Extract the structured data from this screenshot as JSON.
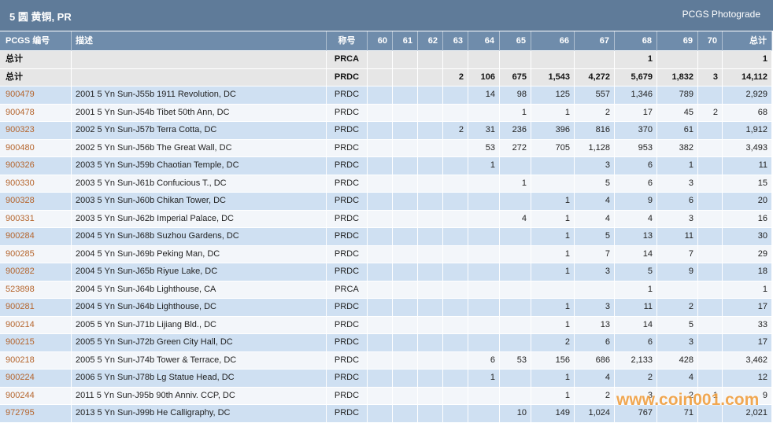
{
  "header": {
    "title": "5 圆 黄铜, PR",
    "photograde_link": "PCGS Photograde"
  },
  "table": {
    "columns": [
      "PCGS 编号",
      "描述",
      "称号",
      "60",
      "61",
      "62",
      "63",
      "64",
      "65",
      "66",
      "67",
      "68",
      "69",
      "70",
      "总计"
    ],
    "total_rows": [
      {
        "label": "总计",
        "description": "",
        "designation": "PRCA",
        "grades": [
          "",
          "",
          "",
          "",
          "",
          "",
          "",
          "",
          "1",
          "",
          ""
        ],
        "total": "1"
      },
      {
        "label": "总计",
        "description": "",
        "designation": "PRDC",
        "grades": [
          "",
          "",
          "",
          "2",
          "106",
          "675",
          "1,543",
          "4,272",
          "5,679",
          "1,832",
          "3"
        ],
        "total": "14,112"
      }
    ],
    "rows": [
      {
        "pcgs_no": "900479",
        "description": "2001 5 Yn Sun-J55b 1911 Revolution, DC",
        "designation": "PRDC",
        "grades": [
          "",
          "",
          "",
          "",
          "14",
          "98",
          "125",
          "557",
          "1,346",
          "789",
          ""
        ],
        "total": "2,929"
      },
      {
        "pcgs_no": "900478",
        "description": "2001 5 Yn Sun-J54b Tibet 50th Ann, DC",
        "designation": "PRDC",
        "grades": [
          "",
          "",
          "",
          "",
          "",
          "1",
          "1",
          "2",
          "17",
          "45",
          "2"
        ],
        "total": "68"
      },
      {
        "pcgs_no": "900323",
        "description": "2002 5 Yn Sun-J57b Terra Cotta, DC",
        "designation": "PRDC",
        "grades": [
          "",
          "",
          "",
          "2",
          "31",
          "236",
          "396",
          "816",
          "370",
          "61",
          ""
        ],
        "total": "1,912"
      },
      {
        "pcgs_no": "900480",
        "description": "2002 5 Yn Sun-J56b The Great Wall, DC",
        "designation": "PRDC",
        "grades": [
          "",
          "",
          "",
          "",
          "53",
          "272",
          "705",
          "1,128",
          "953",
          "382",
          ""
        ],
        "total": "3,493"
      },
      {
        "pcgs_no": "900326",
        "description": "2003 5 Yn Sun-J59b Chaotian Temple, DC",
        "designation": "PRDC",
        "grades": [
          "",
          "",
          "",
          "",
          "1",
          "",
          "",
          "3",
          "6",
          "1",
          ""
        ],
        "total": "11"
      },
      {
        "pcgs_no": "900330",
        "description": "2003 5 Yn Sun-J61b Confucious T., DC",
        "designation": "PRDC",
        "grades": [
          "",
          "",
          "",
          "",
          "",
          "1",
          "",
          "5",
          "6",
          "3",
          ""
        ],
        "total": "15"
      },
      {
        "pcgs_no": "900328",
        "description": "2003 5 Yn Sun-J60b Chikan Tower, DC",
        "designation": "PRDC",
        "grades": [
          "",
          "",
          "",
          "",
          "",
          "",
          "1",
          "4",
          "9",
          "6",
          ""
        ],
        "total": "20"
      },
      {
        "pcgs_no": "900331",
        "description": "2003 5 Yn Sun-J62b Imperial Palace, DC",
        "designation": "PRDC",
        "grades": [
          "",
          "",
          "",
          "",
          "",
          "4",
          "1",
          "4",
          "4",
          "3",
          ""
        ],
        "total": "16"
      },
      {
        "pcgs_no": "900284",
        "description": "2004 5 Yn Sun-J68b Suzhou Gardens, DC",
        "designation": "PRDC",
        "grades": [
          "",
          "",
          "",
          "",
          "",
          "",
          "1",
          "5",
          "13",
          "11",
          ""
        ],
        "total": "30"
      },
      {
        "pcgs_no": "900285",
        "description": "2004 5 Yn Sun-J69b Peking Man, DC",
        "designation": "PRDC",
        "grades": [
          "",
          "",
          "",
          "",
          "",
          "",
          "1",
          "7",
          "14",
          "7",
          ""
        ],
        "total": "29"
      },
      {
        "pcgs_no": "900282",
        "description": "2004 5 Yn Sun-J65b Riyue Lake, DC",
        "designation": "PRDC",
        "grades": [
          "",
          "",
          "",
          "",
          "",
          "",
          "1",
          "3",
          "5",
          "9",
          ""
        ],
        "total": "18"
      },
      {
        "pcgs_no": "523898",
        "description": "2004 5 Yn Sun-J64b Lighthouse, CA",
        "designation": "PRCA",
        "grades": [
          "",
          "",
          "",
          "",
          "",
          "",
          "",
          "",
          "1",
          "",
          ""
        ],
        "total": "1"
      },
      {
        "pcgs_no": "900281",
        "description": "2004 5 Yn Sun-J64b Lighthouse, DC",
        "designation": "PRDC",
        "grades": [
          "",
          "",
          "",
          "",
          "",
          "",
          "1",
          "3",
          "11",
          "2",
          ""
        ],
        "total": "17"
      },
      {
        "pcgs_no": "900214",
        "description": "2005 5 Yn Sun-J71b Lijiang Bld., DC",
        "designation": "PRDC",
        "grades": [
          "",
          "",
          "",
          "",
          "",
          "",
          "1",
          "13",
          "14",
          "5",
          ""
        ],
        "total": "33"
      },
      {
        "pcgs_no": "900215",
        "description": "2005 5 Yn Sun-J72b Green City Hall, DC",
        "designation": "PRDC",
        "grades": [
          "",
          "",
          "",
          "",
          "",
          "",
          "2",
          "6",
          "6",
          "3",
          ""
        ],
        "total": "17"
      },
      {
        "pcgs_no": "900218",
        "description": "2005 5 Yn Sun-J74b Tower & Terrace, DC",
        "designation": "PRDC",
        "grades": [
          "",
          "",
          "",
          "",
          "6",
          "53",
          "156",
          "686",
          "2,133",
          "428",
          ""
        ],
        "total": "3,462"
      },
      {
        "pcgs_no": "900224",
        "description": "2006 5 Yn Sun-J78b Lg Statue Head, DC",
        "designation": "PRDC",
        "grades": [
          "",
          "",
          "",
          "",
          "1",
          "",
          "1",
          "4",
          "2",
          "4",
          ""
        ],
        "total": "12"
      },
      {
        "pcgs_no": "900244",
        "description": "2011 5 Yn Sun-J95b 90th Anniv. CCP, DC",
        "designation": "PRDC",
        "grades": [
          "",
          "",
          "",
          "",
          "",
          "",
          "1",
          "2",
          "3",
          "2",
          "1"
        ],
        "total": "9"
      },
      {
        "pcgs_no": "972795",
        "description": "2013 5 Yn Sun-J99b He Calligraphy, DC",
        "designation": "PRDC",
        "grades": [
          "",
          "",
          "",
          "",
          "",
          "10",
          "149",
          "1,024",
          "767",
          "71",
          ""
        ],
        "total": "2,021"
      }
    ]
  },
  "watermark": "www.coin001.com",
  "colors": {
    "title_bar": "#5f7b99",
    "header_row": "#6f8cab",
    "total_row": "#e6e6e6",
    "row_blue": "#cfe0f2",
    "row_light": "#f3f6fa",
    "id_link": "#b5652d",
    "watermark": "#f09a35"
  }
}
